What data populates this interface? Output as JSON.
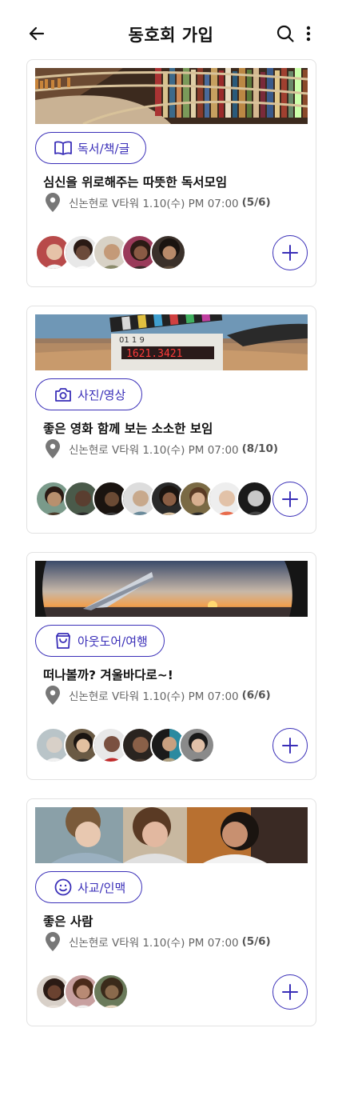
{
  "header": {
    "title": "동호회 가입"
  },
  "clubs": [
    {
      "image": "library-bookshelves",
      "category": "독서/책/글",
      "category_icon": "book-icon",
      "title": "심신을 위로해주는 따뜻한 독서모임",
      "location": "신논현로 V타워 1.10(수) PM 07:00",
      "capacity": "(5/6)",
      "avatar_colors": [
        "#d9b09a",
        "#6b4a3a",
        "#c49a78",
        "#4a2e24",
        "#3a302a"
      ]
    },
    {
      "image": "film-clapperboard-desert",
      "category": "사진/영상",
      "category_icon": "camera-icon",
      "title": "좋은 영화 함께 보는 소소한 보임",
      "location": "신논현로 V타워 1.10(수) PM 07:00",
      "capacity": "(8/10)",
      "avatar_colors": [
        "#9a7a5e",
        "#5a3e30",
        "#3d2b22",
        "#c8a98c",
        "#4b3328",
        "#7a5a44",
        "#d8c0aa",
        "#2e2e2e"
      ]
    },
    {
      "image": "airplane-wing-sunset",
      "category": "아웃도어/여행",
      "category_icon": "bag-icon",
      "title": "떠나볼까? 겨울바다로~!",
      "location": "신논현로 V타워 1.10(수) PM 07:00",
      "capacity": "(6/6)",
      "avatar_colors": [
        "#b9c4c8",
        "#5a4536",
        "#a8322c",
        "#6a4a3a",
        "#2b8aa0",
        "#555555"
      ]
    },
    {
      "image": "people-laughing",
      "category": "사교/인맥",
      "category_icon": "smile-icon",
      "title": "좋은 사람",
      "location": "신논현로 V타워 1.10(수) PM 07:00",
      "capacity": "(5/6)",
      "avatar_colors": [
        "#6a4230",
        "#b88a74",
        "#8a6a4c"
      ]
    }
  ],
  "theme": {
    "accent": "#3a2fb8",
    "icon_gray": "#777777"
  }
}
